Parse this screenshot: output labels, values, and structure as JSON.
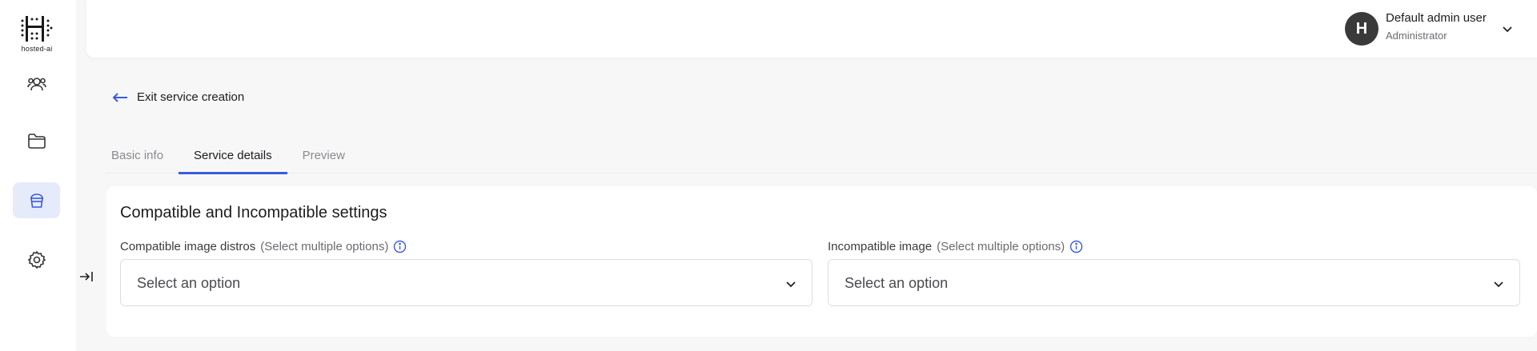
{
  "sidebar": {
    "logo_text": "hosted-ai",
    "items": [
      {
        "icon": "users-icon",
        "active": false
      },
      {
        "icon": "folder-icon",
        "active": false
      },
      {
        "icon": "bucket-icon",
        "active": true
      },
      {
        "icon": "gear-icon",
        "active": false
      }
    ],
    "collapse_icon": "collapse-icon"
  },
  "header": {
    "avatar_initial": "H",
    "user_name": "Default admin user",
    "user_role": "Administrator"
  },
  "exit": {
    "label": "Exit service creation"
  },
  "tabs": [
    {
      "label": "Basic info",
      "active": false
    },
    {
      "label": "Service details",
      "active": true
    },
    {
      "label": "Preview",
      "active": false
    }
  ],
  "card": {
    "title": "Compatible and Incompatible settings",
    "fields": [
      {
        "label": "Compatible image distros",
        "hint": "(Select multiple options)",
        "placeholder": "Select an option"
      },
      {
        "label": "Incompatible image",
        "hint": "(Select multiple options)",
        "placeholder": "Select an option"
      }
    ]
  },
  "colors": {
    "accent": "#3b5bdb",
    "active_nav_bg": "#e6ebfb"
  }
}
